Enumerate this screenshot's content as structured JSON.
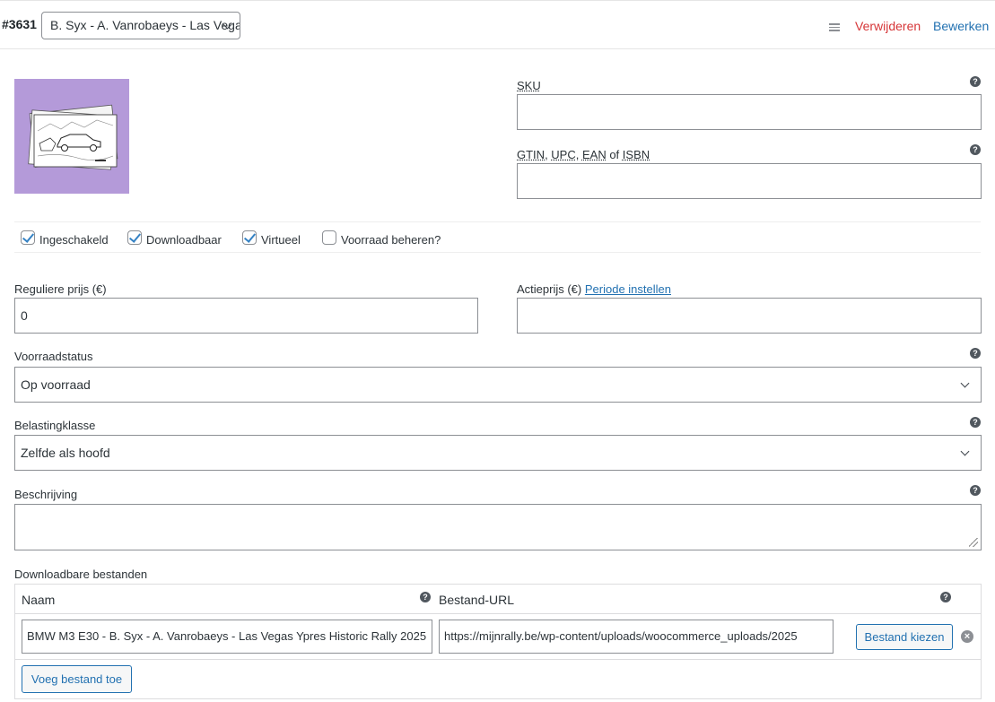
{
  "header": {
    "variation_id": "#3631",
    "variation_select_value": "B. Syx - A. Vanrobaeys - Las Vegas Ypres Historic Rally",
    "delete_label": "Verwijderen",
    "edit_label": "Bewerken"
  },
  "sku": {
    "label": "SKU",
    "value": ""
  },
  "gtin": {
    "label_parts": [
      "GTIN",
      "UPC",
      "EAN",
      "ISBN"
    ],
    "separator_1": ", ",
    "separator_2": ", ",
    "separator_3": " of ",
    "value": ""
  },
  "options": {
    "enabled": {
      "label": "Ingeschakeld",
      "checked": true
    },
    "downloadable": {
      "label": "Downloadbaar",
      "checked": true
    },
    "virtual": {
      "label": "Virtueel",
      "checked": true
    },
    "manage_stock": {
      "label": "Voorraad beheren?",
      "checked": false
    }
  },
  "regular_price": {
    "label": "Reguliere prijs (€)",
    "value": "0"
  },
  "sale_price": {
    "label": "Actieprijs (€)",
    "schedule_link": "Periode instellen",
    "value": ""
  },
  "stock_status": {
    "label": "Voorraadstatus",
    "value": "Op voorraad"
  },
  "tax_class": {
    "label": "Belastingklasse",
    "value": "Zelfde als hoofd"
  },
  "description": {
    "label": "Beschrijving",
    "value": ""
  },
  "downloads": {
    "label": "Downloadbare bestanden",
    "col_name": "Naam",
    "col_url": "Bestand-URL",
    "file_name": "BMW M3 E30 - B. Syx - A. Vanrobaeys - Las Vegas Ypres Historic Rally 2025",
    "file_url": "https://mijnrally.be/wp-content/uploads/woocommerce_uploads/2025",
    "choose_file_label": "Bestand kiezen",
    "remove_symbol": "×",
    "add_file_label": "Voeg bestand toe"
  },
  "icons": {
    "help": "?",
    "help_icon": "question-circle-icon",
    "menu_icon": "hamburger-icon",
    "select_icon": "chevron-down-icon"
  },
  "colors": {
    "link": "#2271b1",
    "danger": "#d63638",
    "thumb_bg": "#b49ad9",
    "checkbox": "#3582c4"
  }
}
